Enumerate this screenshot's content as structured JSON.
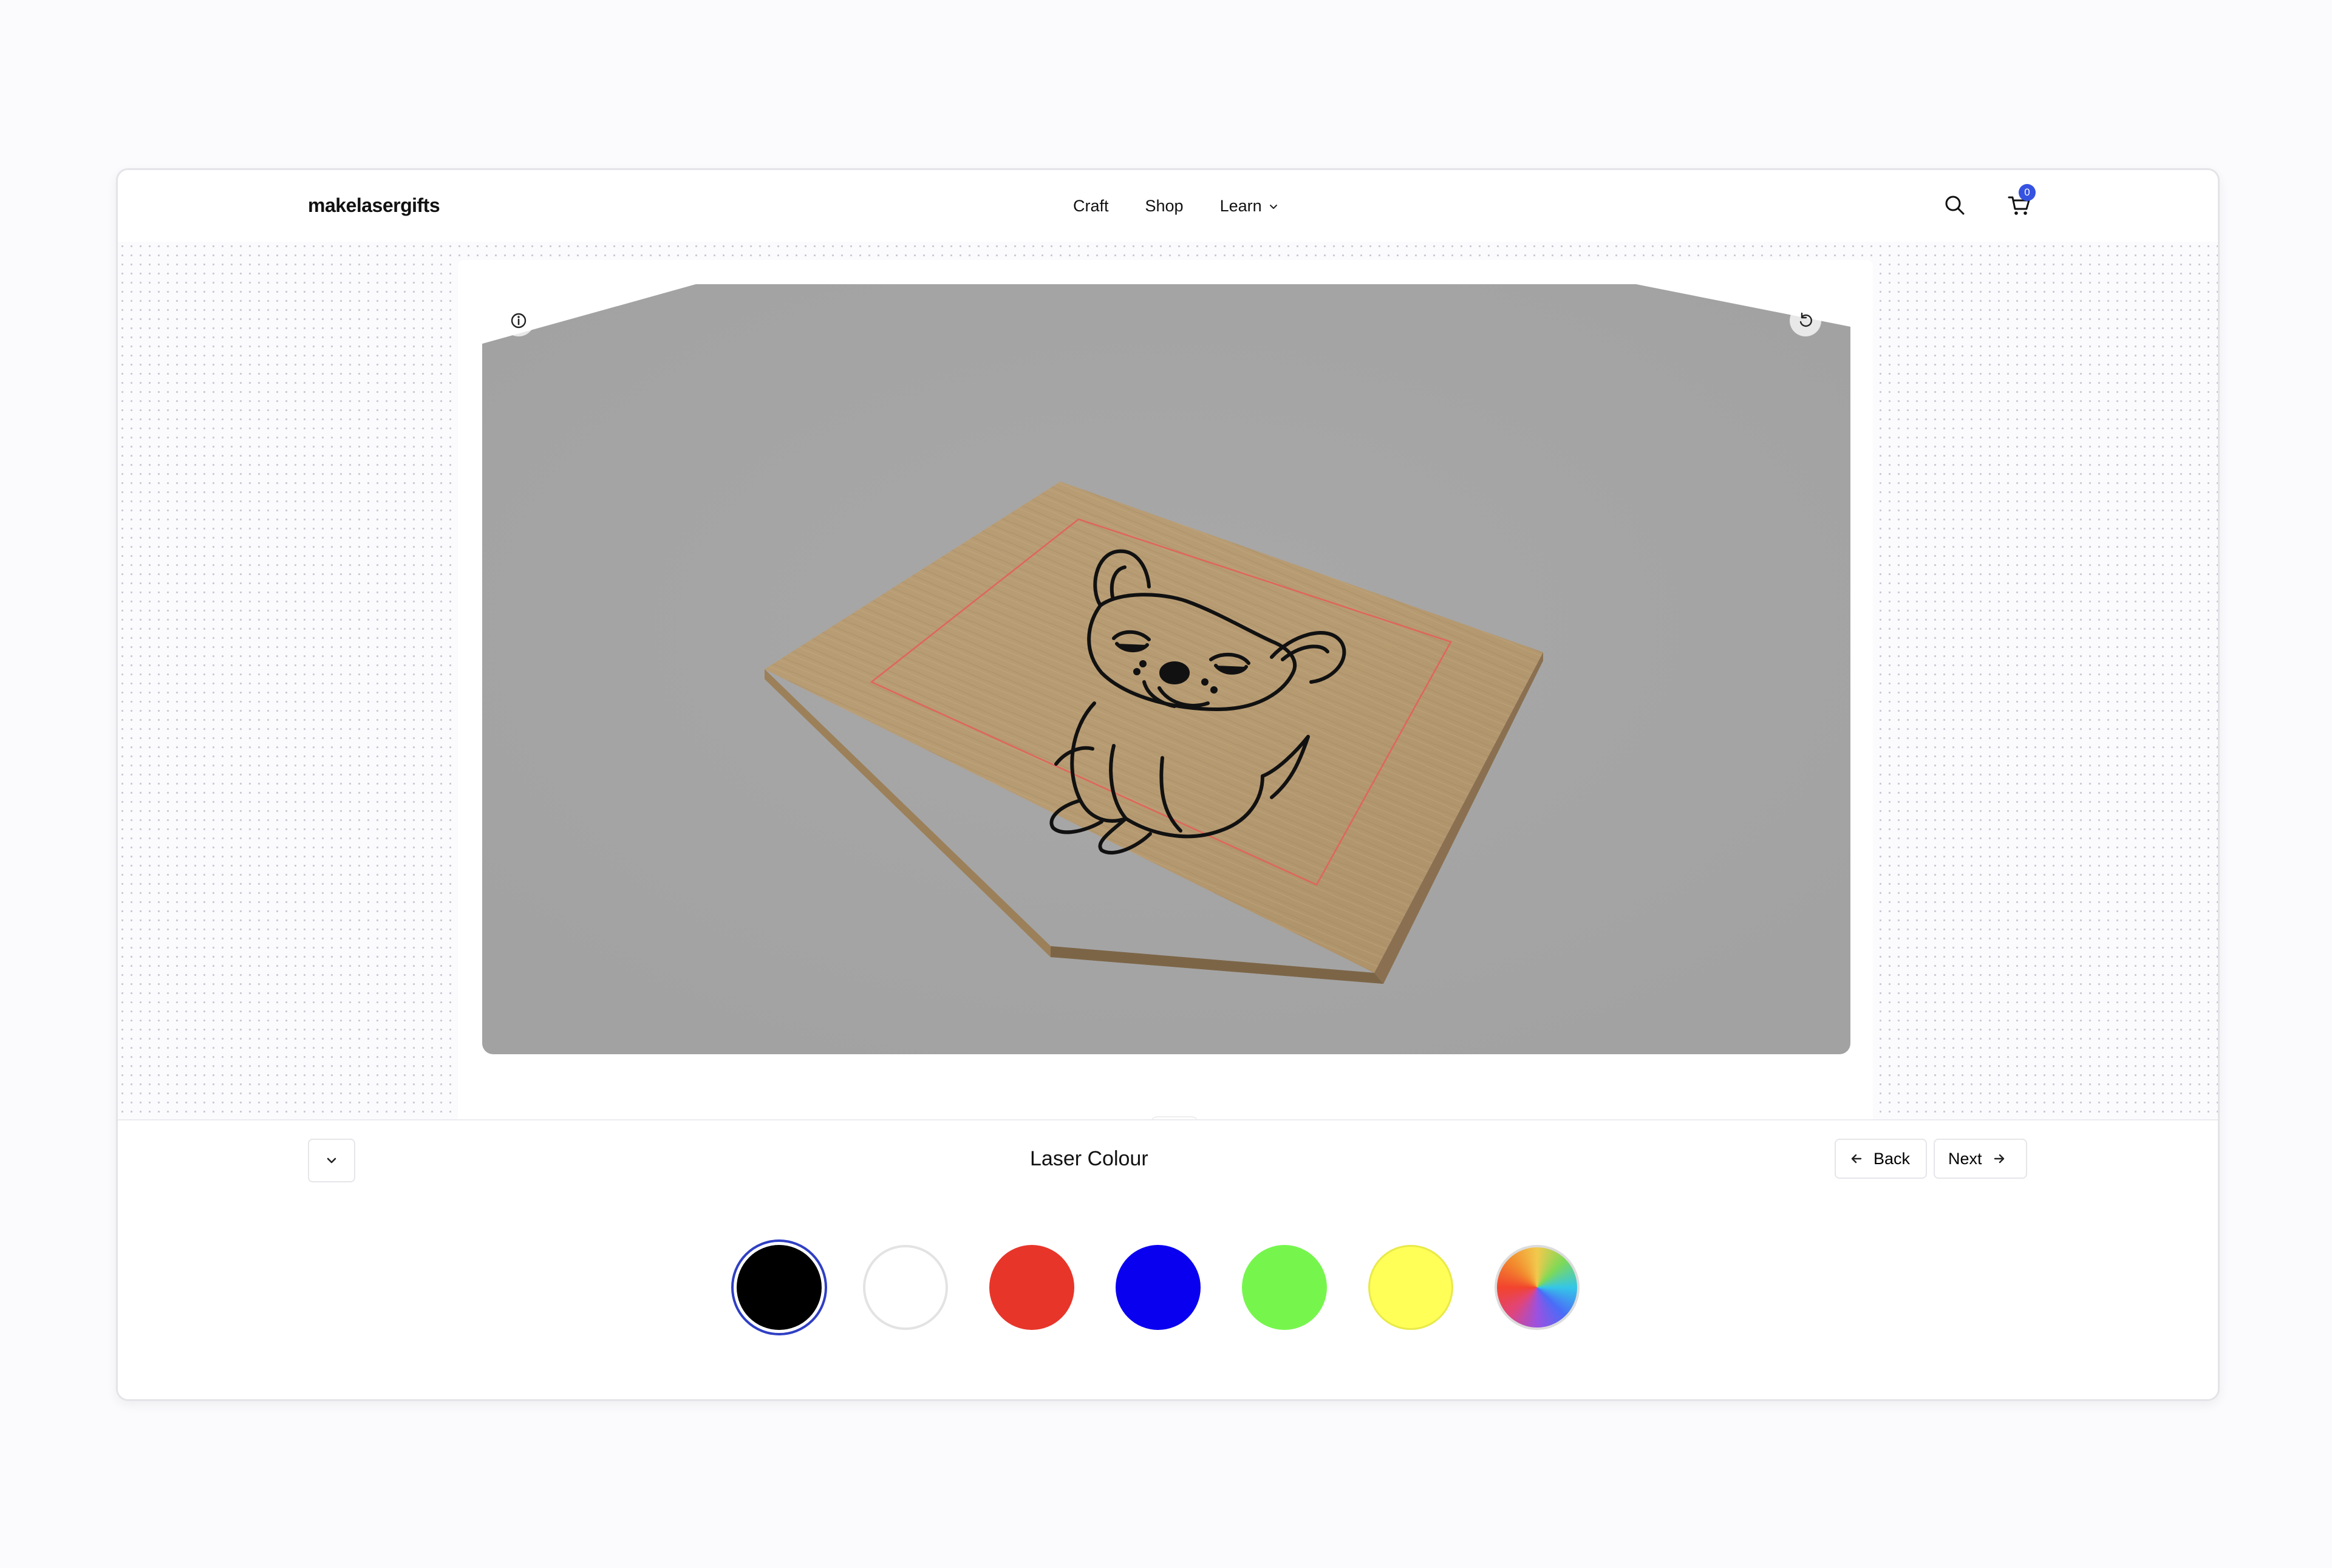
{
  "header": {
    "brand": "makelasergifts",
    "nav": [
      {
        "label": "Craft"
      },
      {
        "label": "Shop"
      },
      {
        "label": "Learn",
        "has_dropdown": true
      }
    ],
    "cart_count": "0",
    "icons": {
      "search": "search-icon",
      "cart": "cart-icon"
    }
  },
  "viewer": {
    "info_icon": "info-icon",
    "reset_icon": "reset-view-icon",
    "colors": {
      "backdrop": "#a5a5a5",
      "wood": "#b69b74",
      "engrave_outline": "#e0655a",
      "engraving": "#111111"
    }
  },
  "panel": {
    "title": "Laser Colour",
    "back_label": "Back",
    "next_label": "Next",
    "swatches": [
      {
        "name": "black",
        "color": "#000000",
        "selected": true
      },
      {
        "name": "white",
        "color": "#ffffff",
        "selected": false
      },
      {
        "name": "red",
        "color": "#e8352a",
        "selected": false
      },
      {
        "name": "blue",
        "color": "#0a00f0",
        "selected": false
      },
      {
        "name": "green",
        "color": "#76f64d",
        "selected": false
      },
      {
        "name": "yellow",
        "color": "#ffff58",
        "selected": false
      },
      {
        "name": "custom",
        "color": "conic",
        "selected": false
      }
    ]
  }
}
